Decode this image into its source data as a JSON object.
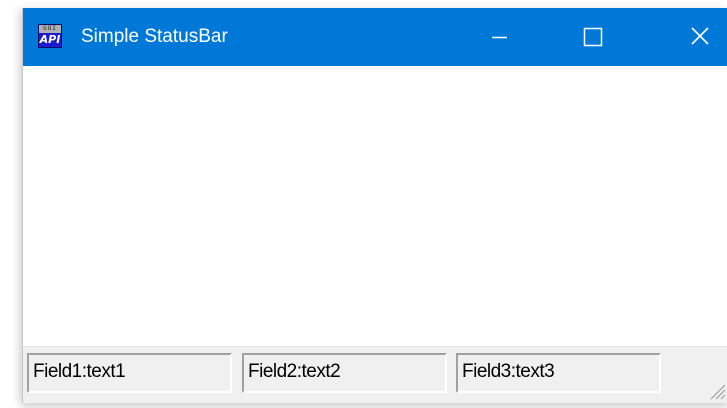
{
  "window": {
    "title": "Simple StatusBar",
    "icon": "api-app-icon",
    "icon_text_top": "GUI",
    "icon_text_bottom": "API",
    "buttons": {
      "minimize": "minimize-icon",
      "maximize": "maximize-icon",
      "close": "close-icon"
    }
  },
  "statusbar": {
    "fields": [
      {
        "text": "Field1:text1"
      },
      {
        "text": "Field2:text2"
      },
      {
        "text": "Field3:text3"
      }
    ],
    "grip": "resize-grip-icon"
  },
  "colors": {
    "titlebar": "#0078d7",
    "statusbar": "#f0f0f0",
    "client": "#ffffff"
  }
}
